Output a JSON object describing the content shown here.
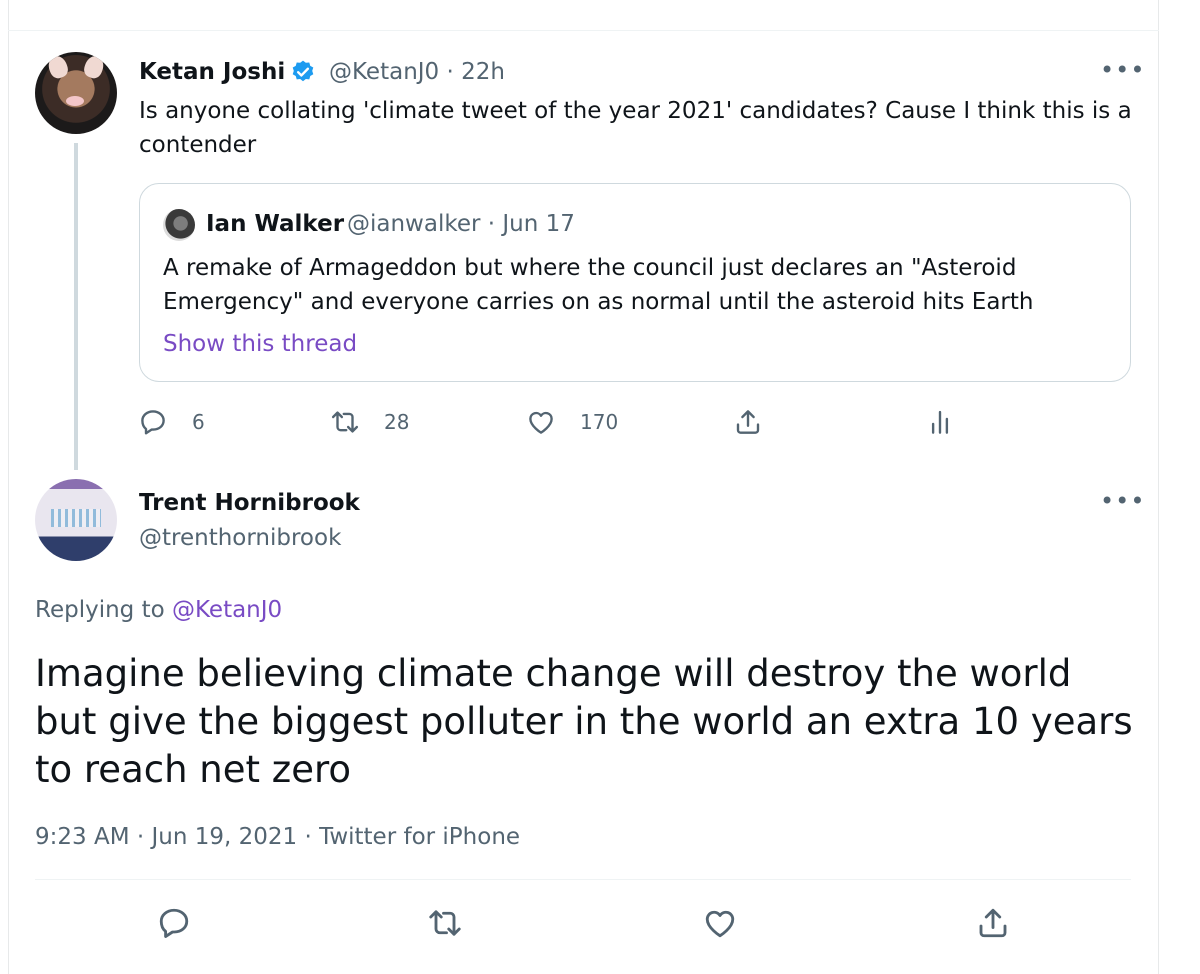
{
  "parent_tweet": {
    "author_name": "Ketan Joshi",
    "meta": "@KetanJ0 · 22h",
    "text": "Is anyone collating 'climate tweet of the year 2021' candidates? Cause I think this is a contender",
    "more_label": "•••",
    "quoted": {
      "author_name": "Ian Walker",
      "meta": "@ianwalker · Jun 17",
      "text": "A remake of Armageddon but where the council just declares an \"Asteroid Emergency\" and everyone carries on as normal until the asteroid hits Earth",
      "link": "Show this thread"
    },
    "actions": {
      "reply_count": "6",
      "retweet_count": "28",
      "like_count": "170"
    }
  },
  "reply_tweet": {
    "author_name": "Trent Hornibrook",
    "handle": "@trenthornibrook",
    "more_label": "•••",
    "replying_prefix": "Replying to ",
    "replying_to": "@KetanJ0",
    "text": "Imagine believing climate change will destroy the world but give the biggest polluter in the world an extra 10 years to reach net zero",
    "timestamp": "9:23 AM · Jun 19, 2021 · Twitter for iPhone"
  },
  "colors": {
    "secondary_text": "#536471",
    "link": "#794bc4",
    "verified": "#1d9bf0",
    "border": "#cfd9de"
  },
  "icons": [
    "reply-icon",
    "retweet-icon",
    "like-icon",
    "share-icon",
    "analytics-icon",
    "verified-icon",
    "more-icon"
  ]
}
